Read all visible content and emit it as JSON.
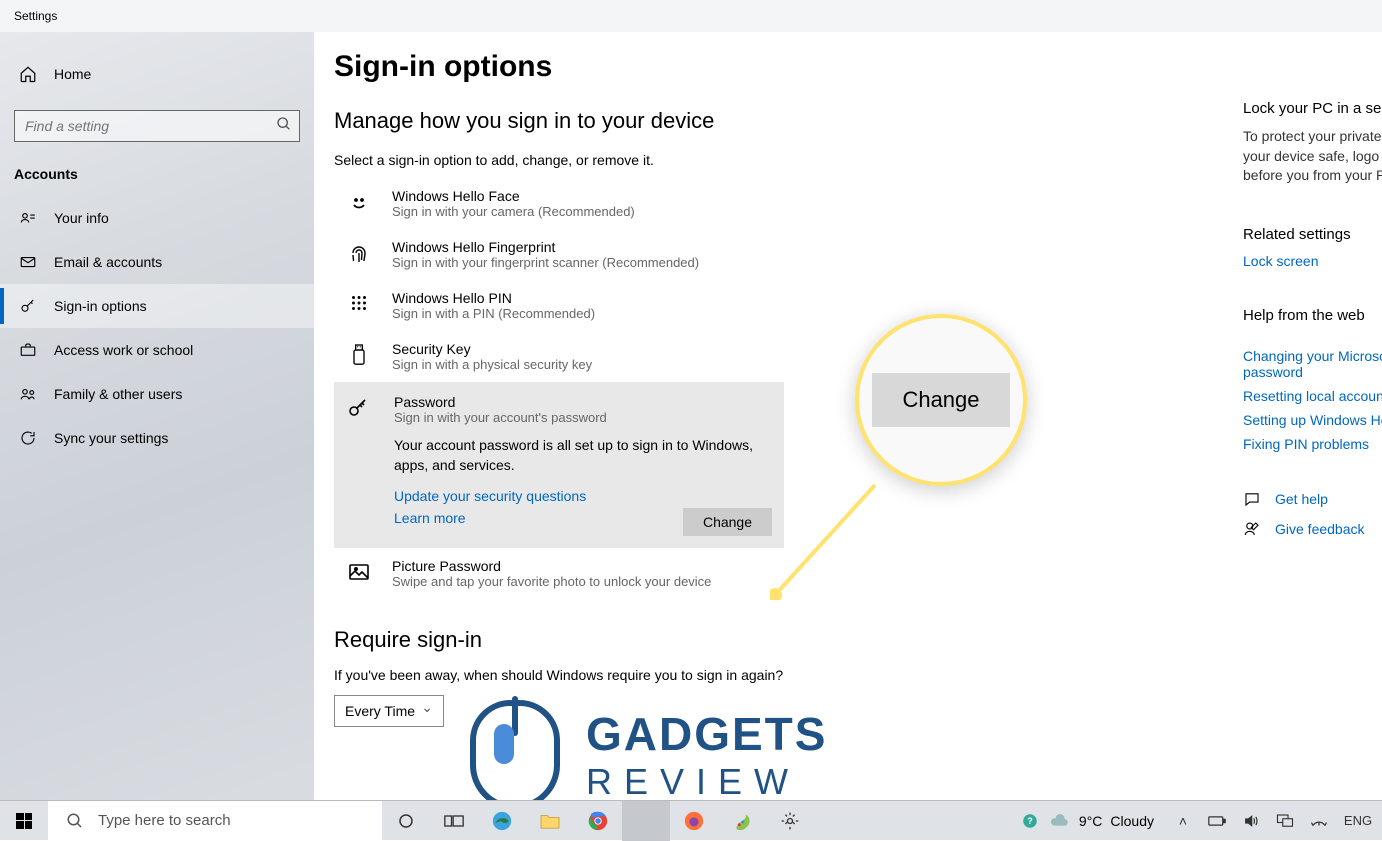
{
  "window_title": "Settings",
  "sidebar": {
    "home": "Home",
    "search_placeholder": "Find a setting",
    "section": "Accounts",
    "items": [
      "Your info",
      "Email & accounts",
      "Sign-in options",
      "Access work or school",
      "Family & other users",
      "Sync your settings"
    ]
  },
  "main": {
    "title": "Sign-in options",
    "subtitle": "Manage how you sign in to your device",
    "hint": "Select a sign-in option to add, change, or remove it.",
    "options": [
      {
        "label": "Windows Hello Face",
        "desc": "Sign in with your camera (Recommended)"
      },
      {
        "label": "Windows Hello Fingerprint",
        "desc": "Sign in with your fingerprint scanner (Recommended)"
      },
      {
        "label": "Windows Hello PIN",
        "desc": "Sign in with a PIN (Recommended)"
      },
      {
        "label": "Security Key",
        "desc": "Sign in with a physical security key"
      }
    ],
    "password": {
      "label": "Password",
      "desc": "Sign in with your account's password",
      "info": "Your account password is all set up to sign in to Windows, apps, and services.",
      "link1": "Update your security questions",
      "link2": "Learn more",
      "button": "Change"
    },
    "picture": {
      "label": "Picture Password",
      "desc": "Swipe and tap your favorite photo to unlock your device"
    },
    "require_title": "Require sign-in",
    "require_desc": "If you've been away, when should Windows require you to sign in again?",
    "require_value": "Every Time"
  },
  "right": {
    "lock_title": "Lock your PC in a secon",
    "lock_body": "To protect your private keep your device safe, logo key + L before you from your PC.",
    "related_title": "Related settings",
    "related_link": "Lock screen",
    "help_title": "Help from the web",
    "help_links": [
      "Changing your Microso password",
      "Resetting local account",
      "Setting up Windows He",
      "Fixing PIN problems"
    ],
    "get_help": "Get help",
    "feedback": "Give feedback"
  },
  "callout_text": "Change",
  "taskbar": {
    "search_placeholder": "Type here to search",
    "weather_temp": "9°C",
    "weather_cond": "Cloudy",
    "lang": "ENG"
  },
  "watermark": {
    "line1": "GADGETS",
    "line2": "REVIEW"
  }
}
